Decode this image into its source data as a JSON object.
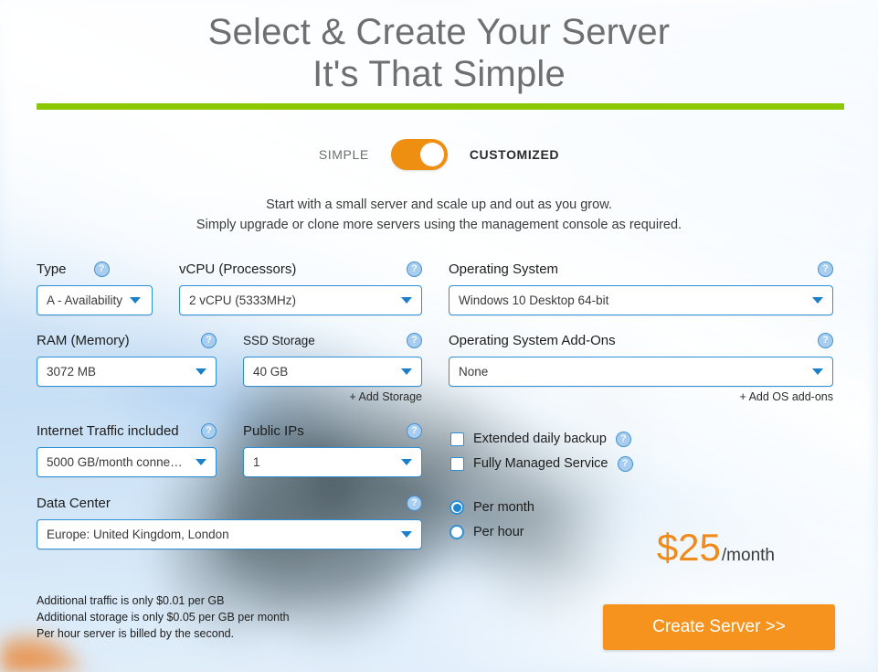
{
  "header": {
    "title_line1": "Select & Create Your Server",
    "title_line2": "It's That Simple",
    "rule_color": "#8cc800"
  },
  "mode_toggle": {
    "left_label": "SIMPLE",
    "right_label": "CUSTOMIZED",
    "state": "CUSTOMIZED",
    "accent_color": "#ee8f12"
  },
  "intro": {
    "line1": "Start with a small server and scale up and out as you grow.",
    "line2": "Simply upgrade or clone more servers using the management console as required."
  },
  "fields": {
    "type": {
      "label": "Type",
      "value": "A - Availability",
      "help": "?"
    },
    "vcpu": {
      "label": "vCPU (Processors)",
      "value": "2 vCPU (5333MHz)",
      "help": "?"
    },
    "os": {
      "label": "Operating System",
      "value": "Windows 10 Desktop 64-bit",
      "help": "?"
    },
    "ram": {
      "label": "RAM (Memory)",
      "value": "3072 MB",
      "help": "?"
    },
    "ssd": {
      "label": "SSD Storage",
      "value": "40 GB",
      "help": "?"
    },
    "os_addons": {
      "label": "Operating System Add-Ons",
      "value": "None",
      "help": "?"
    },
    "traffic": {
      "label": "Internet Traffic included",
      "value": "5000 GB/month conne…",
      "help": "?"
    },
    "public_ips": {
      "label": "Public IPs",
      "value": "1",
      "help": "?"
    },
    "data_center": {
      "label": "Data Center",
      "value": "Europe: United Kingdom, London",
      "help": "?"
    }
  },
  "links": {
    "add_storage": "+ Add Storage",
    "add_os_addons": "+ Add OS add-ons"
  },
  "checkboxes": [
    {
      "label": "Extended daily backup",
      "checked": false,
      "help": "?"
    },
    {
      "label": "Fully Managed Service",
      "checked": false,
      "help": "?"
    }
  ],
  "billing": {
    "options": [
      {
        "label": "Per month",
        "selected": true
      },
      {
        "label": "Per hour",
        "selected": false
      }
    ]
  },
  "price": {
    "amount": "$25",
    "period": "/month",
    "color": "#f08a1b"
  },
  "cta": {
    "label": "Create Server >>",
    "color": "#f5931e"
  },
  "notes": {
    "line1": "Additional traffic is only $0.01 per GB",
    "line2": "Additional storage is only $0.05 per GB per month",
    "line3": "Per hour server is billed by the second."
  }
}
